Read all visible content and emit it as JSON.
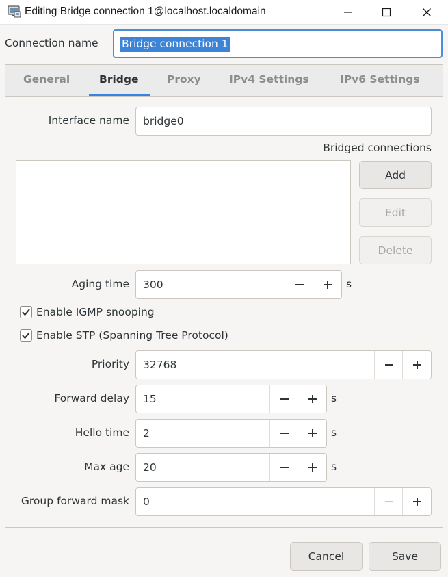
{
  "window": {
    "title": "Editing Bridge connection 1@localhost.localdomain"
  },
  "connection": {
    "label": "Connection name",
    "value": "Bridge connection 1"
  },
  "tabs": [
    {
      "label": "General"
    },
    {
      "label": "Bridge"
    },
    {
      "label": "Proxy"
    },
    {
      "label": "IPv4 Settings"
    },
    {
      "label": "IPv6 Settings"
    }
  ],
  "active_tab": "Bridge",
  "bridge": {
    "interface_name": {
      "label": "Interface name",
      "value": "bridge0"
    },
    "bridged_connections": {
      "label": "Bridged connections",
      "items": [],
      "add_label": "Add",
      "edit_label": "Edit",
      "delete_label": "Delete"
    },
    "aging_time": {
      "label": "Aging time",
      "value": "300",
      "unit": "s"
    },
    "igmp_snooping": {
      "label": "Enable IGMP snooping",
      "checked": true
    },
    "stp": {
      "label": "Enable STP (Spanning Tree Protocol)",
      "checked": true
    },
    "priority": {
      "label": "Priority",
      "value": "32768"
    },
    "forward_delay": {
      "label": "Forward delay",
      "value": "15",
      "unit": "s"
    },
    "hello_time": {
      "label": "Hello time",
      "value": "2",
      "unit": "s"
    },
    "max_age": {
      "label": "Max age",
      "value": "20",
      "unit": "s"
    },
    "group_forward_mask": {
      "label": "Group forward mask",
      "value": "0"
    }
  },
  "footer": {
    "cancel_label": "Cancel",
    "save_label": "Save"
  },
  "colors": {
    "accent": "#3584e4",
    "selection": "#3d84d6",
    "focus_border": "#4a90d9"
  },
  "icons": {
    "app": "network-connection-icon",
    "minimize": "minimize-icon",
    "maximize": "maximize-icon",
    "close": "close-icon",
    "check": "checkmark-icon",
    "minus": "minus-icon",
    "plus": "plus-icon"
  }
}
